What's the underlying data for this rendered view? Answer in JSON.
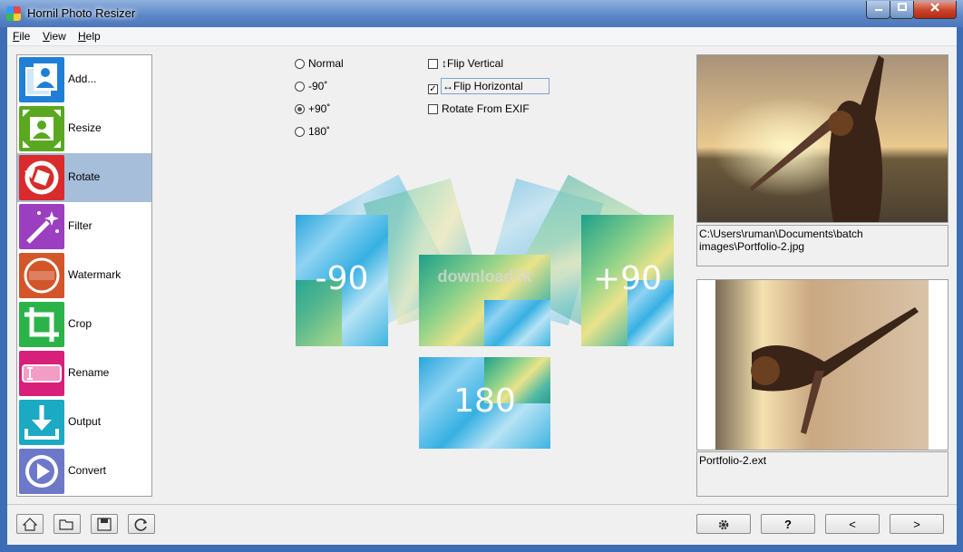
{
  "window": {
    "title": "Hornil Photo Resizer"
  },
  "menu": [
    {
      "accel": "F",
      "rest": "ile"
    },
    {
      "accel": "V",
      "rest": "iew"
    },
    {
      "accel": "H",
      "rest": "elp"
    }
  ],
  "nav": {
    "items": [
      {
        "label": "Add...",
        "icon": "add-photo-icon",
        "color": "#1f7fd6"
      },
      {
        "label": "Resize",
        "icon": "resize-icon",
        "color": "#5aa820"
      },
      {
        "label": "Rotate",
        "icon": "rotate-icon",
        "color": "#d92b2b"
      },
      {
        "label": "Filter",
        "icon": "filter-wand-icon",
        "color": "#9b3fc0"
      },
      {
        "label": "Watermark",
        "icon": "watermark-icon",
        "color": "#d2562a"
      },
      {
        "label": "Crop",
        "icon": "crop-icon",
        "color": "#2bb34a"
      },
      {
        "label": "Rename",
        "icon": "rename-icon",
        "color": "#d81f7a"
      },
      {
        "label": "Output",
        "icon": "output-icon",
        "color": "#1ba9c4"
      },
      {
        "label": "Convert",
        "icon": "convert-icon",
        "color": "#6d79c8"
      }
    ],
    "selected": "Rotate"
  },
  "rotate_options": {
    "radios": [
      {
        "label": "Normal",
        "checked": false
      },
      {
        "label": "-90˚",
        "checked": false
      },
      {
        "label": "+90˚",
        "checked": true
      },
      {
        "label": "180˚",
        "checked": false
      }
    ],
    "checkboxes": [
      {
        "label": "↕Flip Vertical",
        "checked": false
      },
      {
        "label": "↔Flip Horizontal",
        "checked": true
      },
      {
        "label": "Rotate From EXIF",
        "checked": false
      }
    ]
  },
  "illustration": {
    "labels": {
      "minus90": "-90",
      "plus90": "+90",
      "r180": "180"
    },
    "watermark_text": "download3k"
  },
  "preview": {
    "source_path": "C:\\Users\\ruman\\Documents\\batch images\\Portfolio-2.jpg",
    "output_name": "Portfolio-2.ext"
  },
  "toolbar": {
    "left_icons": [
      "home-icon",
      "open-folder-icon",
      "save-icon",
      "refresh-icon"
    ],
    "settings_icon": "gear-icon",
    "help_label": "?",
    "prev_label": "<",
    "next_label": ">"
  },
  "colors": {
    "selection": "#a6bed9",
    "titlebar": "#5b85c5",
    "close": "#c8432a"
  }
}
